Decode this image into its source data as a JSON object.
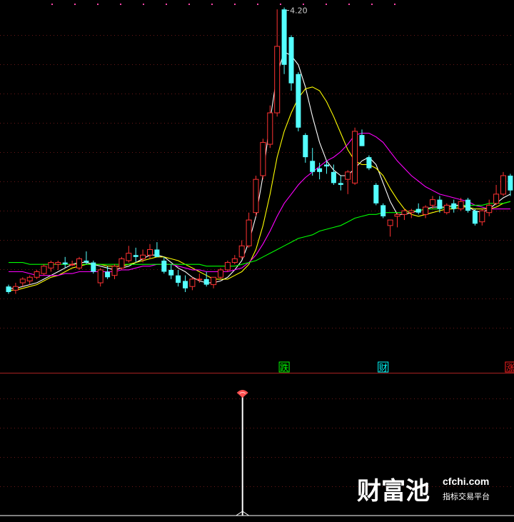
{
  "chart_data": [
    {
      "type": "candlestick",
      "x_count": 72,
      "peak_label": "4.20",
      "ylim": [
        2.55,
        4.22
      ],
      "candles": [
        [
          2.7,
          2.71,
          2.66,
          2.67
        ],
        [
          2.68,
          2.72,
          2.66,
          2.7
        ],
        [
          2.72,
          2.75,
          2.7,
          2.74
        ],
        [
          2.73,
          2.76,
          2.71,
          2.75
        ],
        [
          2.75,
          2.79,
          2.74,
          2.78
        ],
        [
          2.77,
          2.82,
          2.76,
          2.81
        ],
        [
          2.8,
          2.84,
          2.78,
          2.83
        ],
        [
          2.82,
          2.84,
          2.79,
          2.83
        ],
        [
          2.83,
          2.86,
          2.8,
          2.82
        ],
        [
          2.82,
          2.84,
          2.81,
          2.82
        ],
        [
          2.8,
          2.86,
          2.79,
          2.85
        ],
        [
          2.84,
          2.89,
          2.82,
          2.83
        ],
        [
          2.83,
          2.84,
          2.77,
          2.78
        ],
        [
          2.72,
          2.8,
          2.7,
          2.79
        ],
        [
          2.78,
          2.81,
          2.74,
          2.75
        ],
        [
          2.76,
          2.82,
          2.74,
          2.81
        ],
        [
          2.8,
          2.86,
          2.79,
          2.85
        ],
        [
          2.84,
          2.92,
          2.83,
          2.88
        ],
        [
          2.87,
          2.91,
          2.83,
          2.86
        ],
        [
          2.85,
          2.9,
          2.83,
          2.87
        ],
        [
          2.87,
          2.93,
          2.85,
          2.9
        ],
        [
          2.9,
          2.94,
          2.86,
          2.86
        ],
        [
          2.84,
          2.86,
          2.77,
          2.78
        ],
        [
          2.79,
          2.82,
          2.74,
          2.76
        ],
        [
          2.76,
          2.79,
          2.7,
          2.72
        ],
        [
          2.73,
          2.76,
          2.67,
          2.69
        ],
        [
          2.7,
          2.75,
          2.68,
          2.74
        ],
        [
          2.74,
          2.77,
          2.72,
          2.74
        ],
        [
          2.74,
          2.78,
          2.7,
          2.71
        ],
        [
          2.71,
          2.75,
          2.69,
          2.75
        ],
        [
          2.75,
          2.8,
          2.74,
          2.79
        ],
        [
          2.79,
          2.84,
          2.78,
          2.83
        ],
        [
          2.83,
          2.87,
          2.82,
          2.85
        ],
        [
          2.86,
          2.95,
          2.85,
          2.92
        ],
        [
          2.92,
          3.1,
          2.91,
          3.06
        ],
        [
          3.1,
          3.3,
          3.08,
          3.28
        ],
        [
          3.3,
          3.5,
          3.28,
          3.48
        ],
        [
          3.47,
          3.68,
          3.45,
          3.64
        ],
        [
          3.64,
          4.2,
          3.62,
          4.0
        ],
        [
          4.2,
          4.21,
          3.85,
          3.9
        ],
        [
          4.05,
          4.06,
          3.76,
          3.8
        ],
        [
          3.85,
          3.86,
          3.54,
          3.56
        ],
        [
          3.52,
          3.53,
          3.37,
          3.4
        ],
        [
          3.38,
          3.45,
          3.3,
          3.32
        ],
        [
          3.34,
          3.37,
          3.28,
          3.32
        ],
        [
          3.36,
          3.38,
          3.31,
          3.35
        ],
        [
          3.32,
          3.36,
          3.25,
          3.26
        ],
        [
          3.26,
          3.3,
          3.22,
          3.25
        ],
        [
          3.28,
          3.33,
          3.2,
          3.32
        ],
        [
          3.26,
          3.56,
          3.25,
          3.54
        ],
        [
          3.52,
          3.55,
          3.46,
          3.46
        ],
        [
          3.4,
          3.41,
          3.33,
          3.34
        ],
        [
          3.25,
          3.26,
          3.14,
          3.15
        ],
        [
          3.14,
          3.15,
          3.07,
          3.08
        ],
        [
          3.03,
          3.06,
          2.97,
          3.06
        ],
        [
          3.08,
          3.1,
          3.02,
          3.09
        ],
        [
          3.09,
          3.12,
          3.06,
          3.11
        ],
        [
          3.1,
          3.12,
          3.07,
          3.11
        ],
        [
          3.12,
          3.15,
          3.09,
          3.1
        ],
        [
          3.09,
          3.14,
          3.07,
          3.13
        ],
        [
          3.14,
          3.19,
          3.12,
          3.17
        ],
        [
          3.17,
          3.19,
          3.1,
          3.12
        ],
        [
          3.1,
          3.15,
          3.09,
          3.14
        ],
        [
          3.15,
          3.17,
          3.1,
          3.12
        ],
        [
          3.12,
          3.18,
          3.11,
          3.16
        ],
        [
          3.17,
          3.18,
          3.1,
          3.11
        ],
        [
          3.11,
          3.12,
          3.03,
          3.04
        ],
        [
          3.05,
          3.12,
          3.03,
          3.11
        ],
        [
          3.1,
          3.17,
          3.08,
          3.14
        ],
        [
          3.15,
          3.25,
          3.14,
          3.2
        ],
        [
          3.2,
          3.32,
          3.19,
          3.3
        ],
        [
          3.3,
          3.31,
          3.19,
          3.22
        ]
      ],
      "ma_series": [
        {
          "color": "#ffffff",
          "values": [
            2.69,
            2.69,
            2.7,
            2.71,
            2.72,
            2.74,
            2.76,
            2.78,
            2.8,
            2.82,
            2.83,
            2.83,
            2.82,
            2.81,
            2.8,
            2.79,
            2.8,
            2.81,
            2.83,
            2.85,
            2.87,
            2.87,
            2.86,
            2.83,
            2.8,
            2.78,
            2.75,
            2.73,
            2.72,
            2.72,
            2.73,
            2.75,
            2.79,
            2.84,
            2.94,
            3.08,
            3.3,
            3.6,
            3.85,
            3.97,
            3.95,
            3.9,
            3.78,
            3.62,
            3.48,
            3.38,
            3.33,
            3.3,
            3.3,
            3.34,
            3.38,
            3.4,
            3.36,
            3.26,
            3.16,
            3.09,
            3.09,
            3.1,
            3.11,
            3.12,
            3.13,
            3.13,
            3.13,
            3.14,
            3.14,
            3.13,
            3.11,
            3.1,
            3.12,
            3.15,
            3.18,
            3.2
          ]
        },
        {
          "color": "#ffff00",
          "values": [
            2.68,
            2.68,
            2.69,
            2.7,
            2.71,
            2.73,
            2.75,
            2.76,
            2.78,
            2.8,
            2.81,
            2.82,
            2.82,
            2.82,
            2.81,
            2.81,
            2.81,
            2.82,
            2.83,
            2.84,
            2.85,
            2.86,
            2.86,
            2.85,
            2.84,
            2.82,
            2.8,
            2.78,
            2.76,
            2.74,
            2.74,
            2.74,
            2.76,
            2.78,
            2.82,
            2.9,
            3.03,
            3.2,
            3.4,
            3.54,
            3.64,
            3.72,
            3.77,
            3.78,
            3.76,
            3.7,
            3.62,
            3.53,
            3.44,
            3.38,
            3.36,
            3.36,
            3.34,
            3.3,
            3.23,
            3.17,
            3.12,
            3.09,
            3.08,
            3.09,
            3.1,
            3.11,
            3.12,
            3.12,
            3.13,
            3.13,
            3.12,
            3.12,
            3.12,
            3.13,
            3.15,
            3.16
          ]
        },
        {
          "color": "#ff00ff",
          "values": [
            2.78,
            2.78,
            2.78,
            2.77,
            2.76,
            2.76,
            2.76,
            2.76,
            2.77,
            2.77,
            2.78,
            2.78,
            2.78,
            2.78,
            2.78,
            2.78,
            2.79,
            2.79,
            2.8,
            2.81,
            2.81,
            2.82,
            2.82,
            2.82,
            2.81,
            2.8,
            2.79,
            2.79,
            2.78,
            2.78,
            2.78,
            2.78,
            2.79,
            2.8,
            2.83,
            2.87,
            2.93,
            3.0,
            3.08,
            3.15,
            3.2,
            3.25,
            3.29,
            3.32,
            3.35,
            3.38,
            3.4,
            3.43,
            3.47,
            3.52,
            3.53,
            3.53,
            3.51,
            3.48,
            3.43,
            3.38,
            3.34,
            3.3,
            3.27,
            3.24,
            3.22,
            3.2,
            3.19,
            3.18,
            3.17,
            3.16,
            3.14,
            3.13,
            3.12,
            3.12,
            3.12,
            3.12
          ]
        },
        {
          "color": "#00ff00",
          "values": [
            2.83,
            2.83,
            2.83,
            2.82,
            2.82,
            2.82,
            2.82,
            2.82,
            2.82,
            2.82,
            2.82,
            2.82,
            2.82,
            2.82,
            2.82,
            2.82,
            2.82,
            2.82,
            2.82,
            2.82,
            2.82,
            2.82,
            2.82,
            2.82,
            2.82,
            2.82,
            2.82,
            2.82,
            2.81,
            2.81,
            2.81,
            2.81,
            2.81,
            2.82,
            2.83,
            2.84,
            2.86,
            2.88,
            2.9,
            2.92,
            2.94,
            2.96,
            2.97,
            2.98,
            3.0,
            3.01,
            3.02,
            3.03,
            3.05,
            3.07,
            3.08,
            3.09,
            3.09,
            3.1,
            3.1,
            3.1,
            3.1,
            3.11,
            3.11,
            3.12,
            3.12,
            3.12,
            3.13,
            3.13,
            3.14,
            3.14,
            3.14,
            3.14,
            3.15,
            3.15,
            3.15,
            3.16
          ]
        }
      ],
      "markers": [
        {
          "index": 39,
          "text": "跌",
          "color": "#00ff00"
        },
        {
          "index": 53,
          "text": "财",
          "color": "#00ffff"
        },
        {
          "index": 71,
          "text": "涨",
          "color": "#ff2020"
        }
      ]
    },
    {
      "type": "signal",
      "x_count": 72,
      "values": [
        0,
        0,
        0,
        0,
        0,
        0,
        0,
        0,
        0,
        0,
        0,
        0,
        0,
        0,
        0,
        0,
        0,
        0,
        0,
        0,
        0,
        0,
        0,
        0,
        0,
        0,
        0,
        0,
        0,
        0,
        0,
        0,
        0,
        1,
        0,
        0,
        0,
        0,
        0,
        0,
        0,
        0,
        0,
        0,
        0,
        0,
        0,
        0,
        0,
        0,
        0,
        0,
        0,
        0,
        0,
        0,
        0,
        0,
        0,
        0,
        0,
        0,
        0,
        0,
        0,
        0,
        0,
        0,
        0,
        0,
        0,
        0
      ],
      "ylim": [
        0,
        1
      ]
    }
  ],
  "watermark": {
    "brand": "财富池",
    "domain": "cfchi.com",
    "tagline": "指标交易平台"
  }
}
